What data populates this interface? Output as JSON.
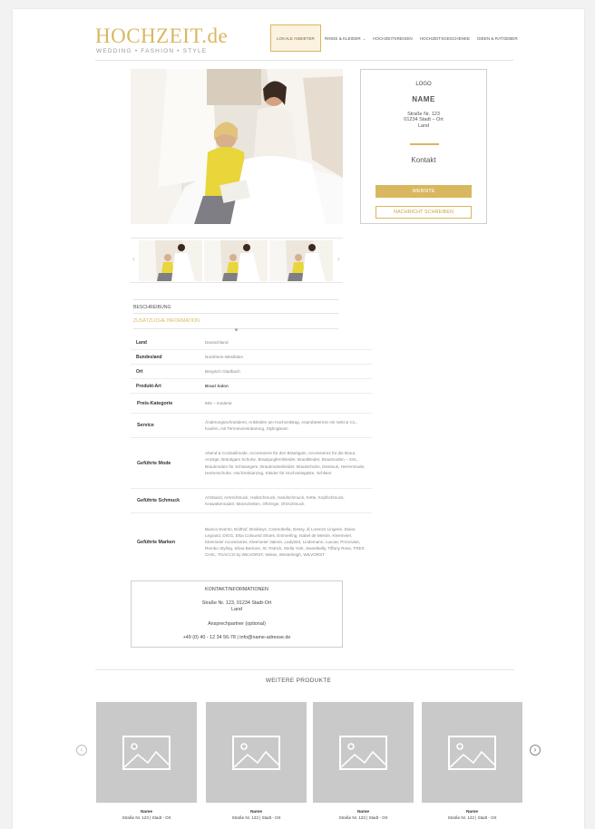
{
  "header": {
    "logo": "HOCHZEIT.de",
    "tagline": "WEDDING  •  FASHION  •  STYLE",
    "nav": [
      {
        "label": "LOKALE ANBIETER",
        "active": true
      },
      {
        "label": "RINGE & KLEIDER",
        "dropdown": true
      },
      {
        "label": "HOCHZEITSREISEN"
      },
      {
        "label": "HOCHZEITSGESCHENKE"
      },
      {
        "label": "IDEEN & RATGEBER"
      }
    ]
  },
  "vendor_card": {
    "logo": "LOGO",
    "name": "NAME",
    "street": "Straße Nr. 123",
    "city": "01234 Stadt – Ort",
    "country": "Land",
    "kontakt": "Kontakt",
    "website_button": "WEBSITE",
    "message_button": "NACHRICHT SCHREIBEN"
  },
  "tabs": {
    "description": "BESCHREIBUNG",
    "additional": "ZUSÄTZLICHE INFORMATION"
  },
  "info_rows": [
    {
      "key": "Land",
      "value": "Deutschland"
    },
    {
      "key": "Bundesland",
      "value": "Nordrhein-Westfalen"
    },
    {
      "key": "Ort",
      "value": "Bergisch Gladbach"
    },
    {
      "key": "Produkt-Art",
      "value": "Braut Salon"
    },
    {
      "key": "Preis-Kategorie",
      "value": "€€€ – moderat"
    },
    {
      "key": "Service",
      "value": "Änderungsschneiderei, Ankleiden am Hochzeitstag, Anprobetermin mit Sekt & Co., Kaufen, mit Terminvereinbarung, Stylingteam"
    },
    {
      "key": "Geführte Mode",
      "value": "Abend & Cocktailmode, Accessoires für den Bräutigam, Accessoires für die Braut, Anzüge, Bräutigam Schuhe, Brautjungfernkleider, Brautkleider, Brautmoden – XXL, Brautmoden für Schwangere, Brautmutterkleider, Brautschuhe, Dessous, Herrenmode, Herrenschuhe, Hochzeitsanzug, Kleider für Hochzeitsgäste, Schleier"
    },
    {
      "key": "Geführte Schmuck",
      "value": "Armband, Armschmuck, Halsschmuck, Handschmuck, Kette, Kopfschmuck, Krawattennadel, Manschetten, Ohrringe, Ohrschmuck"
    },
    {
      "key": "Geführte Marken",
      "value": "Bianco Evento, Bolthof, Brinkleys, Cosmobella, Dessy, di Lorenzo Lingerie, Diane Legrand, DIGG, Elsa Coloured Shoes, Emmerling, Isabel de Mestre, Kleemeier, Kleemeier Accessoires, Kleemeier Valerie, Ladybird, Lindemann, Luxuar, Pronovias, Rembo Styling, Silvia Bertone, St. Patrick, Stella York, Sweetbelly, Tiffany Rose, TRES CHIC, TOACCO by WILVORST, Weise, Westerleigh, WILVORST"
    }
  ],
  "contact_info": {
    "title": "KONTAKTINFORMATIONEN",
    "address": "Straße Nr. 123, 01234 Stadt-Ort",
    "country": "Land",
    "contact_person": "Ansprechpartner (optional)",
    "phone_email": "+49 (0) 40 - 12 34 56-78  |  info@name-adresse.de"
  },
  "more_products": {
    "title": "WEITERE PRODUKTE",
    "items": [
      {
        "name": "Name",
        "address": "Straße Nr. 123  |  Stadt - Ort"
      },
      {
        "name": "Name",
        "address": "Straße Nr. 123  |  Stadt - Ort"
      },
      {
        "name": "Name",
        "address": "Straße Nr. 123  |  Stadt - Ort"
      },
      {
        "name": "Name",
        "address": "Straße Nr. 123  |  Stadt - Ort"
      }
    ],
    "prev_icon": "chevron-left-icon",
    "next_icon": "chevron-right-icon"
  },
  "colors": {
    "accent": "#d8b75f",
    "placeholder": "#c9c9c9"
  }
}
